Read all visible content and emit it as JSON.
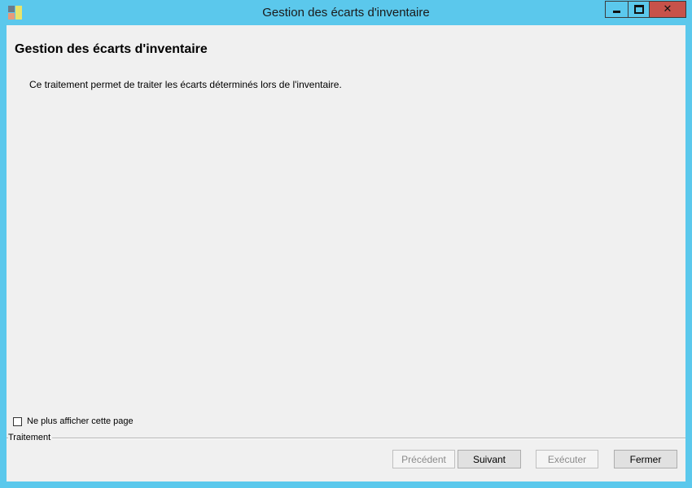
{
  "window": {
    "title": "Gestion des écarts d'inventaire"
  },
  "content": {
    "heading": "Gestion des écarts d'inventaire",
    "description": "Ce traitement permet de traiter les écarts déterminés lors de l'inventaire."
  },
  "options": {
    "hide_page_label": "Ne plus afficher cette page",
    "hide_page_checked": false
  },
  "group": {
    "label": "Traitement"
  },
  "buttons": {
    "previous": "Précédent",
    "next": "Suivant",
    "execute": "Exécuter",
    "close": "Fermer"
  },
  "icons": {
    "app": "app-icon",
    "minimize": "minimize-icon",
    "maximize": "maximize-icon",
    "close": "close-icon"
  },
  "colors": {
    "titlebar": "#5bc8ec",
    "close_button": "#c7524a",
    "client_background": "#f0f0f0"
  }
}
